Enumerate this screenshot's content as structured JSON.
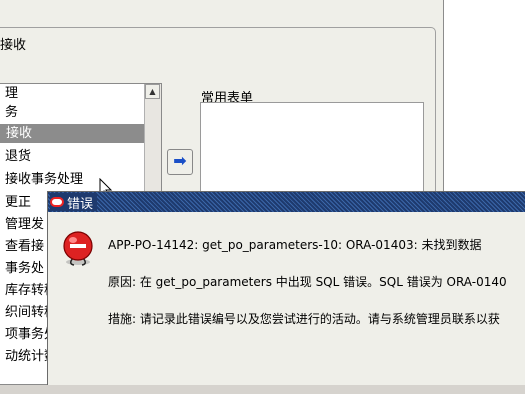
{
  "background": {
    "group_title": "接收",
    "nav_label": "理",
    "nav_items": [
      {
        "label": "接收",
        "selected": true
      },
      {
        "label": "退货"
      },
      {
        "label": "接收事务处理"
      },
      {
        "label": "更正"
      },
      {
        "label": "管理发"
      },
      {
        "label": "查看接"
      },
      {
        "label": "事务处"
      },
      {
        "label": "库存转移"
      },
      {
        "label": "织间转移"
      },
      {
        "label": "项事务处"
      },
      {
        "label": "动统计数"
      }
    ],
    "nav_partial_top": "务",
    "favorites_label": "常用表单",
    "move_button_icon": "right-arrow-icon"
  },
  "dialog": {
    "title": "错误",
    "icon": "stop-sign-icon",
    "message_code": "APP-PO-14142: get_po_parameters-10: ORA-01403: 未找到数据",
    "cause": "原因: 在 get_po_parameters 中出现 SQL 错误。SQL 错误为 ORA-0140",
    "action": "措施: 请记录此错误编号以及您尝试进行的活动。请与系统管理员联系以获"
  },
  "colors": {
    "titlebar": "#1e3a6e",
    "selection": "#8c8c8c",
    "stop_red": "#dd2222"
  }
}
